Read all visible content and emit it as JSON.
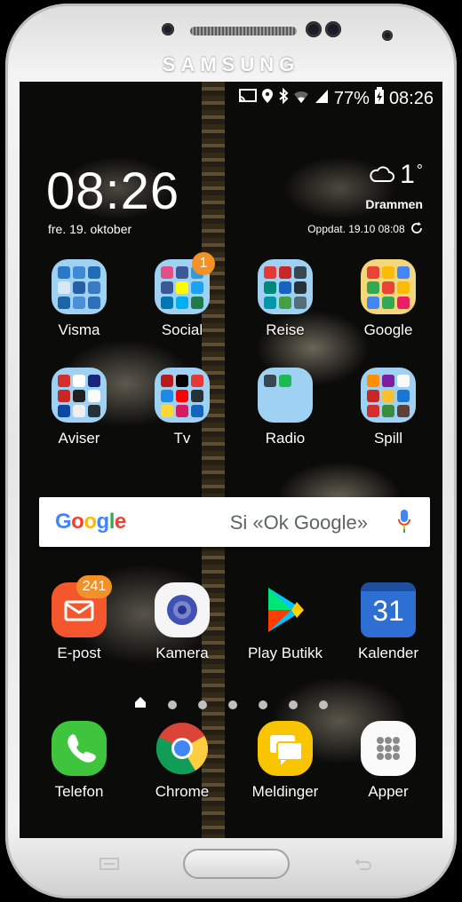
{
  "device": {
    "brand": "SAMSUNG"
  },
  "status_bar": {
    "battery": "77%",
    "time": "08:26",
    "icons": [
      "cast-icon",
      "location-icon",
      "bluetooth-icon",
      "wifi-icon",
      "signal-icon",
      "battery-icon"
    ]
  },
  "clock_widget": {
    "time": "08:26",
    "date": "fre. 19. oktober"
  },
  "weather_widget": {
    "temperature": "1",
    "degree": "°",
    "city": "Drammen",
    "updated": "Oppdat. 19.10 08:08"
  },
  "apps_row1": [
    {
      "label": "Visma"
    },
    {
      "label": "Social",
      "badge": "1"
    },
    {
      "label": "Reise"
    },
    {
      "label": "Google"
    }
  ],
  "apps_row2": [
    {
      "label": "Aviser"
    },
    {
      "label": "Tv"
    },
    {
      "label": "Radio"
    },
    {
      "label": "Spill"
    }
  ],
  "search_bar": {
    "logo": "Google",
    "hint": "Si «Ok Google»"
  },
  "apps_row3": [
    {
      "label": "E-post",
      "badge": "241"
    },
    {
      "label": "Kamera"
    },
    {
      "label": "Play Butikk"
    },
    {
      "label": "Kalender",
      "date": "31"
    }
  ],
  "dock": [
    {
      "label": "Telefon"
    },
    {
      "label": "Chrome"
    },
    {
      "label": "Meldinger"
    },
    {
      "label": "Apper"
    }
  ],
  "colors": {
    "badge": "#f39127",
    "folder": "#9fd2f2",
    "email": "#f4572d",
    "phone": "#3ec43d",
    "messages": "#f9c400",
    "calendar": "#2d6fd2"
  }
}
